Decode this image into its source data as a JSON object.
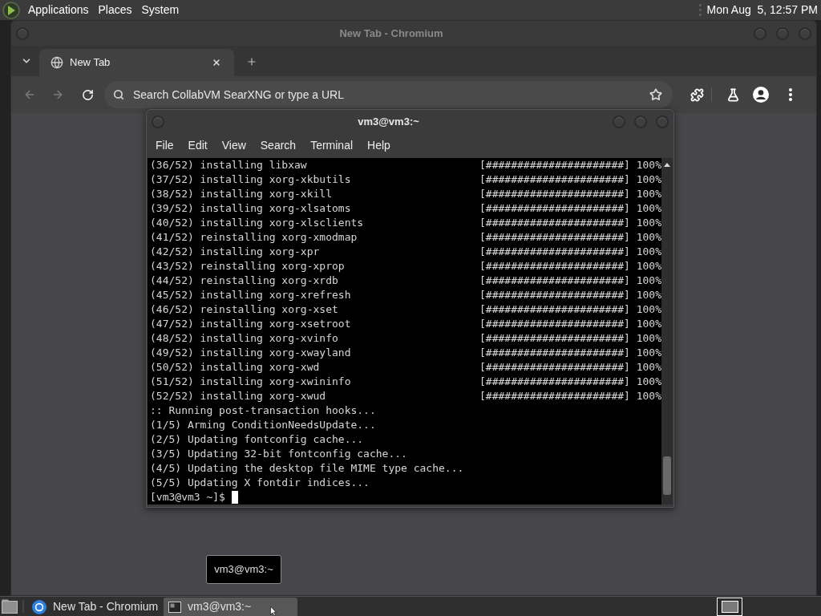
{
  "top_panel": {
    "menus": [
      "Applications",
      "Places",
      "System"
    ],
    "clock": "Mon Aug  5, 12:57 PM"
  },
  "browser": {
    "title": "New Tab - Chromium",
    "tabs": [
      {
        "label": "New Tab",
        "selected": true
      }
    ],
    "address_bar": {
      "placeholder": "Search CollabVM SearXNG or type a URL"
    }
  },
  "terminal": {
    "title": "vm3@vm3:~",
    "menus": [
      "File",
      "Edit",
      "View",
      "Search",
      "Terminal",
      "Help"
    ],
    "lines": [
      {
        "kind": "progress",
        "text": "(36/52) installing libxaw",
        "bar": "[######################]",
        "percent": "100%"
      },
      {
        "kind": "progress",
        "text": "(37/52) installing xorg-xkbutils",
        "bar": "[######################]",
        "percent": "100%"
      },
      {
        "kind": "progress",
        "text": "(38/52) installing xorg-xkill",
        "bar": "[######################]",
        "percent": "100%"
      },
      {
        "kind": "progress",
        "text": "(39/52) installing xorg-xlsatoms",
        "bar": "[######################]",
        "percent": "100%"
      },
      {
        "kind": "progress",
        "text": "(40/52) installing xorg-xlsclients",
        "bar": "[######################]",
        "percent": "100%"
      },
      {
        "kind": "progress",
        "text": "(41/52) reinstalling xorg-xmodmap",
        "bar": "[######################]",
        "percent": "100%"
      },
      {
        "kind": "progress",
        "text": "(42/52) installing xorg-xpr",
        "bar": "[######################]",
        "percent": "100%"
      },
      {
        "kind": "progress",
        "text": "(43/52) reinstalling xorg-xprop",
        "bar": "[######################]",
        "percent": "100%"
      },
      {
        "kind": "progress",
        "text": "(44/52) reinstalling xorg-xrdb",
        "bar": "[######################]",
        "percent": "100%"
      },
      {
        "kind": "progress",
        "text": "(45/52) installing xorg-xrefresh",
        "bar": "[######################]",
        "percent": "100%"
      },
      {
        "kind": "progress",
        "text": "(46/52) reinstalling xorg-xset",
        "bar": "[######################]",
        "percent": "100%"
      },
      {
        "kind": "progress",
        "text": "(47/52) installing xorg-xsetroot",
        "bar": "[######################]",
        "percent": "100%"
      },
      {
        "kind": "progress",
        "text": "(48/52) installing xorg-xvinfo",
        "bar": "[######################]",
        "percent": "100%"
      },
      {
        "kind": "progress",
        "text": "(49/52) installing xorg-xwayland",
        "bar": "[######################]",
        "percent": "100%"
      },
      {
        "kind": "progress",
        "text": "(50/52) installing xorg-xwd",
        "bar": "[######################]",
        "percent": "100%"
      },
      {
        "kind": "progress",
        "text": "(51/52) installing xorg-xwininfo",
        "bar": "[######################]",
        "percent": "100%"
      },
      {
        "kind": "progress",
        "text": "(52/52) installing xorg-xwud",
        "bar": "[######################]",
        "percent": "100%"
      },
      {
        "kind": "output",
        "text": ":: Running post-transaction hooks..."
      },
      {
        "kind": "output",
        "text": "(1/5) Arming ConditionNeedsUpdate..."
      },
      {
        "kind": "output",
        "text": "(2/5) Updating fontconfig cache..."
      },
      {
        "kind": "output",
        "text": "(3/5) Updating 32-bit fontconfig cache..."
      },
      {
        "kind": "output",
        "text": "(4/5) Updating the desktop file MIME type cache..."
      },
      {
        "kind": "output",
        "text": "(5/5) Updating X fontdir indices..."
      },
      {
        "kind": "prompt",
        "text": "[vm3@vm3 ~]$"
      }
    ]
  },
  "tooltip": "vm3@vm3:~",
  "taskbar": {
    "items": [
      {
        "kind": "browser",
        "label": "New Tab - Chromium",
        "selected": false
      },
      {
        "kind": "terminal",
        "label": "vm3@vm3:~",
        "selected": true
      }
    ]
  }
}
